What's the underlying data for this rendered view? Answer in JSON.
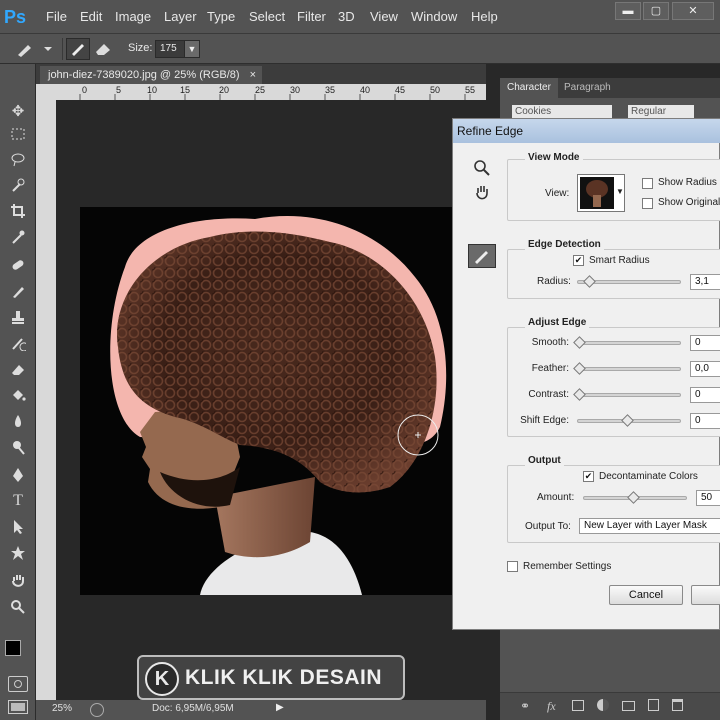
{
  "app": {
    "logo": "Ps"
  },
  "menu": [
    "File",
    "Edit",
    "Image",
    "Layer",
    "Type",
    "Select",
    "Filter",
    "3D",
    "View",
    "Window",
    "Help"
  ],
  "window_controls": {
    "minimize": "▬",
    "maximize": "▢",
    "close": "✕"
  },
  "options_bar": {
    "size_label": "Size:",
    "size_value": "175"
  },
  "document": {
    "tab_title": "john-diez-7389020.jpg @ 25% (RGB/8)",
    "tab_close": "×",
    "ruler_ticks": [
      "0",
      "5",
      "10",
      "15",
      "20",
      "25",
      "30",
      "35",
      "40",
      "45",
      "50",
      "55"
    ]
  },
  "status": {
    "zoom": "25%",
    "doc": "Doc: 6,95M/6,95M"
  },
  "right_panel": {
    "tabs": [
      "Character",
      "Paragraph"
    ],
    "font_family": "Cookies",
    "font_style": "Regular"
  },
  "dialog": {
    "title": "Refine Edge",
    "view_mode": {
      "title": "View Mode",
      "view_label": "View:",
      "show_radius": "Show Radius (",
      "show_original": "Show Original"
    },
    "edge_detection": {
      "title": "Edge Detection",
      "smart_radius": "Smart Radius",
      "smart_radius_checked": true,
      "radius_label": "Radius:",
      "radius_value": "3,1",
      "radius_fraction": 0.1
    },
    "adjust_edge": {
      "title": "Adjust Edge",
      "items": [
        {
          "label": "Smooth:",
          "value": "0",
          "fraction": 0.0
        },
        {
          "label": "Feather:",
          "value": "0,0",
          "fraction": 0.0
        },
        {
          "label": "Contrast:",
          "value": "0",
          "fraction": 0.0
        },
        {
          "label": "Shift Edge:",
          "value": "0",
          "fraction": 0.5
        }
      ]
    },
    "output": {
      "title": "Output",
      "decontaminate": "Decontaminate Colors",
      "decontaminate_checked": true,
      "amount_label": "Amount:",
      "amount_value": "50",
      "amount_fraction": 0.5,
      "output_to_label": "Output To:",
      "output_to_value": "New Layer with Layer Mask"
    },
    "remember": "Remember Settings",
    "cancel": "Cancel"
  },
  "watermark": {
    "text": "KLIK KLIK DESAIN",
    "logo_letter": "K"
  },
  "colors": {
    "accent": "#31a8ff",
    "overlay_pink": "#f4b6ae",
    "dialog_bg": "#f0f0f0"
  }
}
